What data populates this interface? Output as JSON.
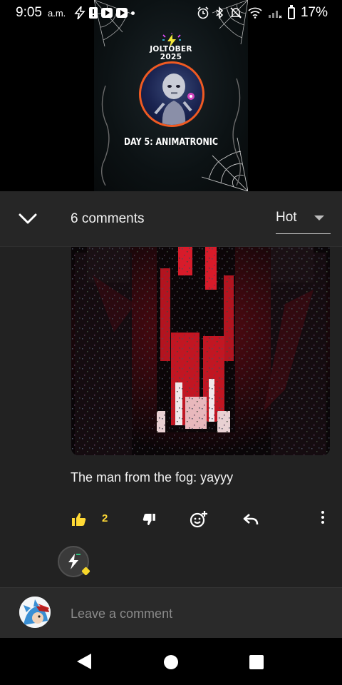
{
  "status_bar": {
    "time": "9:05",
    "ampm": "a.m.",
    "battery": "17%",
    "left_icons": [
      "bolt-icon",
      "alert-icon",
      "youtube-icon",
      "youtube-icon",
      "dot-icon"
    ],
    "right_icons": [
      "alarm-icon",
      "bluetooth-icon",
      "mute-icon",
      "wifi-icon",
      "signal-icon",
      "battery-icon"
    ]
  },
  "post": {
    "event_title": "JOLTOBER\n2025",
    "day_label": "DAY 5: ANIMATRONIC"
  },
  "comments": {
    "count_label": "6 comments",
    "sort_value": "Hot",
    "items": [
      {
        "text": "The man from the fog: yayyy",
        "likes": "2"
      }
    ]
  },
  "composer": {
    "placeholder": "Leave a comment"
  },
  "colors": {
    "accent_yellow": "#ffd935",
    "portrait_ring": "#f05a22",
    "panel_bg": "#222222",
    "composer_bg": "#2a2a2a"
  }
}
